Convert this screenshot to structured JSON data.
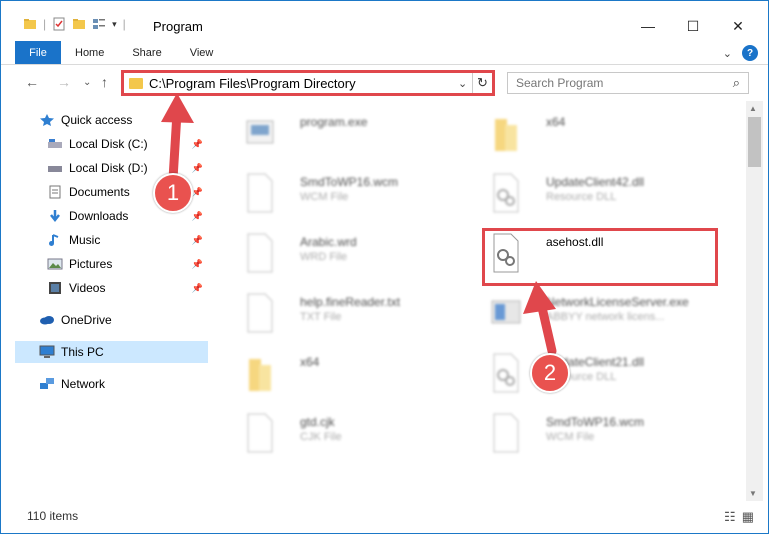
{
  "window": {
    "title": "Program",
    "minimize": "—",
    "maximize": "☐",
    "close": "✕"
  },
  "ribbon": {
    "tabs": [
      "File",
      "Home",
      "Share",
      "View"
    ],
    "collapse_chevron": "⌄",
    "help": "?"
  },
  "address": {
    "path": "C:\\Program Files\\Program Directory",
    "search_placeholder": "Search Program"
  },
  "nav": {
    "items": [
      {
        "label": "Quick access",
        "icon": "star-icon",
        "pinned": false
      },
      {
        "label": "Local Disk (C:)",
        "icon": "drive-icon",
        "pinned": true
      },
      {
        "label": "Local Disk (D:)",
        "icon": "drive-icon",
        "pinned": true
      },
      {
        "label": "Documents",
        "icon": "documents-icon",
        "pinned": true
      },
      {
        "label": "Downloads",
        "icon": "download-icon",
        "pinned": true
      },
      {
        "label": "Music",
        "icon": "music-icon",
        "pinned": true
      },
      {
        "label": "Pictures",
        "icon": "pictures-icon",
        "pinned": true
      },
      {
        "label": "Videos",
        "icon": "videos-icon",
        "pinned": true
      },
      {
        "label": "OneDrive",
        "icon": "cloud-icon",
        "pinned": false
      },
      {
        "label": "This PC",
        "icon": "computer-icon",
        "pinned": false
      },
      {
        "label": "Network",
        "icon": "network-icon",
        "pinned": false
      }
    ]
  },
  "files": [
    {
      "name": "program.exe",
      "type": "",
      "icon": "exe",
      "blur": true
    },
    {
      "name": "x64",
      "type": "",
      "icon": "folder",
      "blur": true
    },
    {
      "name": "SmdToWP16.wcm",
      "type": "WCM File",
      "icon": "doc",
      "blur": true
    },
    {
      "name": "UpdateClient42.dll",
      "type": "Resource DLL",
      "icon": "dll",
      "blur": true
    },
    {
      "name": "Arabic.wrd",
      "type": "WRD File",
      "icon": "doc",
      "blur": true
    },
    {
      "name": "asehost.dll",
      "type": "",
      "icon": "dll",
      "blur": false
    },
    {
      "name": "help.fineReader.txt",
      "type": "TXT File",
      "icon": "doc",
      "blur": true
    },
    {
      "name": "NetworkLicenseServer.exe",
      "type": "ABBYY network licens...",
      "icon": "exe-blue",
      "blur": true
    },
    {
      "name": "x64",
      "type": "",
      "icon": "folder",
      "blur": true
    },
    {
      "name": "UpdateClient21.dll",
      "type": "Resource DLL",
      "icon": "dll",
      "blur": true
    },
    {
      "name": "gtd.cjk",
      "type": "CJK File",
      "icon": "doc",
      "blur": true
    },
    {
      "name": "SmdToWP16.wcm",
      "type": "WCM File",
      "icon": "doc",
      "blur": true
    }
  ],
  "status": {
    "count": "110 items"
  },
  "annotations": {
    "step1": "1",
    "step2": "2"
  },
  "colors": {
    "accent": "#1a73c9",
    "highlight": "#e0474c",
    "selected_nav": "#cce8ff"
  }
}
